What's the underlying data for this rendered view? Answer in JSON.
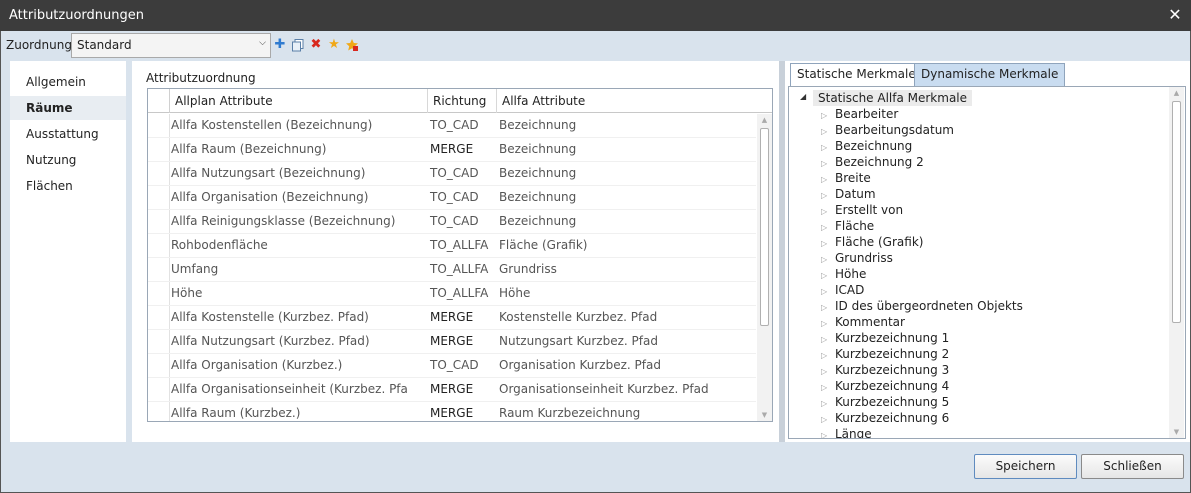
{
  "window": {
    "title": "Attributzuordnungen",
    "close_icon": "close-icon"
  },
  "toolbar": {
    "label": "Zuordnung",
    "selected": "Standard",
    "icons": [
      "add-icon",
      "copy-icon",
      "delete-icon",
      "favorite-star-icon",
      "favorite-edit-icon"
    ]
  },
  "nav": {
    "items": [
      "Allgemein",
      "Räume",
      "Ausstattung",
      "Nutzung",
      "Flächen"
    ],
    "selected": "Räume"
  },
  "center": {
    "heading": "Attributzuordnung",
    "columns": [
      "Allplan Attribute",
      "Richtung",
      "Allfa Attribute"
    ],
    "rows": [
      [
        "Allfa Kostenstellen (Bezeichnung)",
        "TO_CAD",
        "Bezeichnung"
      ],
      [
        "Allfa Raum (Bezeichnung)",
        "MERGE",
        "Bezeichnung"
      ],
      [
        "Allfa Nutzungsart (Bezeichnung)",
        "TO_CAD",
        "Bezeichnung"
      ],
      [
        "Allfa Organisation (Bezeichnung)",
        "TO_CAD",
        "Bezeichnung"
      ],
      [
        "Allfa Reinigungsklasse (Bezeichnung)",
        "TO_CAD",
        "Bezeichnung"
      ],
      [
        "Rohbodenfläche",
        "TO_ALLFA",
        "Fläche (Grafik)"
      ],
      [
        "Umfang",
        "TO_ALLFA",
        "Grundriss"
      ],
      [
        "Höhe",
        "TO_ALLFA",
        "Höhe"
      ],
      [
        "Allfa Kostenstelle (Kurzbez. Pfad)",
        "MERGE",
        "Kostenstelle Kurzbez. Pfad"
      ],
      [
        "Allfa Nutzungsart (Kurzbez. Pfad)",
        "MERGE",
        "Nutzungsart Kurzbez. Pfad"
      ],
      [
        "Allfa Organisation (Kurzbez.)",
        "TO_CAD",
        "Organisation Kurzbez. Pfad"
      ],
      [
        "Allfa Organisationseinheit (Kurzbez. Pfa",
        "MERGE",
        "Organisationseinheit Kurzbez. Pfad"
      ],
      [
        "Allfa Raum (Kurzbez.)",
        "MERGE",
        "Raum Kurzbezeichnung"
      ]
    ]
  },
  "right": {
    "tabs": [
      "Statische Merkmale",
      "Dynamische Merkmale"
    ],
    "active_tab": "Statische Merkmale",
    "root": "Statische Allfa Merkmale",
    "nodes": [
      "Bearbeiter",
      "Bearbeitungsdatum",
      "Bezeichnung",
      "Bezeichnung 2",
      "Breite",
      "Datum",
      "Erstellt von",
      "Fläche",
      "Fläche (Grafik)",
      "Grundriss",
      "Höhe",
      "ICAD",
      "ID des übergeordneten Objekts",
      "Kommentar",
      "Kurzbezeichnung 1",
      "Kurzbezeichnung 2",
      "Kurzbezeichnung 3",
      "Kurzbezeichnung 4",
      "Kurzbezeichnung 5",
      "Kurzbezeichnung 6",
      "Länge"
    ]
  },
  "footer": {
    "save_label": "Speichern",
    "close_label": "Schließen"
  },
  "colors": {
    "titlebar": "#3c3c3c",
    "chrome": "#d9e3ed",
    "tab_inactive": "#c9dcf0",
    "accent": "#5f8bbf"
  }
}
